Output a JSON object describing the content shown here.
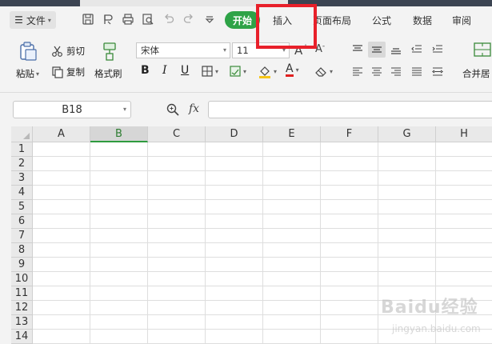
{
  "menu": {
    "file_label": "文件",
    "start_label": "开始",
    "tabs": [
      "插入",
      "页面布局",
      "公式",
      "数据",
      "审阅"
    ]
  },
  "ribbon": {
    "paste_label": "粘贴",
    "cut_label": "剪切",
    "copy_label": "复制",
    "format_painter_label": "格式刷",
    "font_name": "宋体",
    "font_size": "11",
    "merge_label": "合并居"
  },
  "formula_bar": {
    "cell_ref": "B18",
    "fx_label": "fx",
    "formula": ""
  },
  "grid": {
    "columns": [
      "A",
      "B",
      "C",
      "D",
      "E",
      "F",
      "G",
      "H"
    ],
    "active_column": "B",
    "rows": [
      "1",
      "2",
      "3",
      "4",
      "5",
      "6",
      "7",
      "8",
      "9",
      "10",
      "11",
      "12",
      "13",
      "14"
    ]
  },
  "watermark": {
    "main": "Baidu经验",
    "sub": "jingyan.baidu.com"
  },
  "colors": {
    "accent_green": "#2ea347",
    "highlight_red": "#e8202a",
    "font_color_red": "#e02020",
    "fill_yellow": "#f5c518"
  }
}
